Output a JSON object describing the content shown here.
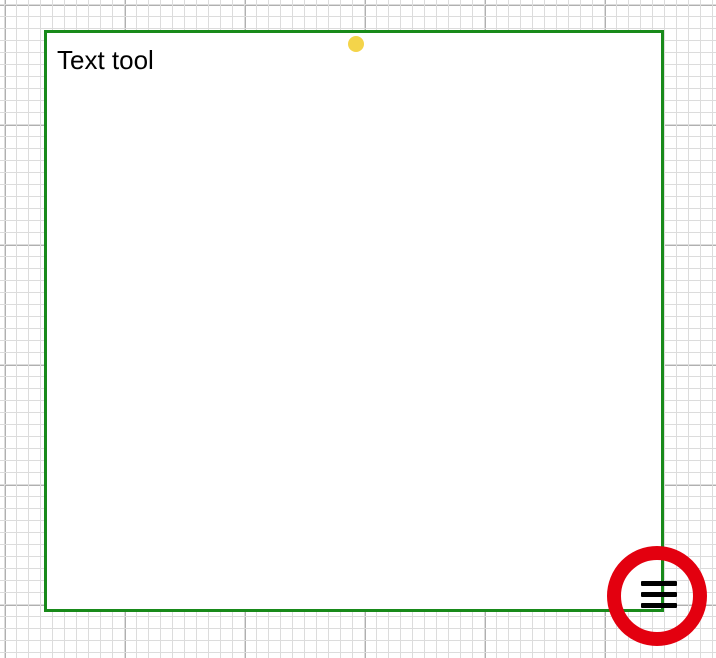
{
  "canvas": {
    "textbox": {
      "content": "Text tool"
    },
    "selection": {
      "border_color": "#188a1a",
      "rotate_handle_color": "#f4d44a"
    }
  },
  "menu": {
    "icon_name": "menu-icon"
  },
  "annotation": {
    "highlight_color": "#e3000f"
  }
}
